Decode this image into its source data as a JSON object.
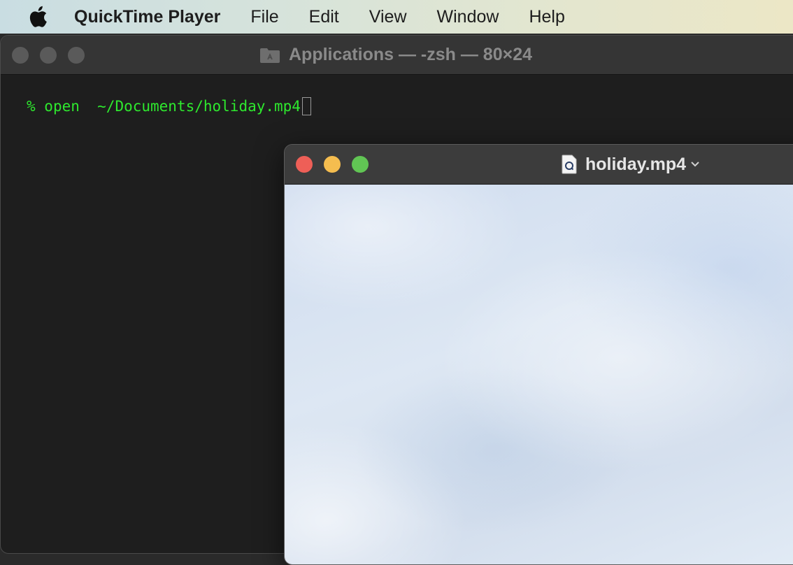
{
  "menubar": {
    "app_name": "QuickTime Player",
    "items": [
      "File",
      "Edit",
      "View",
      "Window",
      "Help"
    ]
  },
  "terminal": {
    "title": "Applications — -zsh — 80×24",
    "prompt": "% ",
    "command": "open  ~/Documents/holiday.mp4",
    "text_color": "#2ee82e"
  },
  "quicktime": {
    "title": "holiday.mp4",
    "traffic_lights": {
      "close": "#ee5f57",
      "minimize": "#f5bd4f",
      "zoom": "#61c554"
    }
  }
}
